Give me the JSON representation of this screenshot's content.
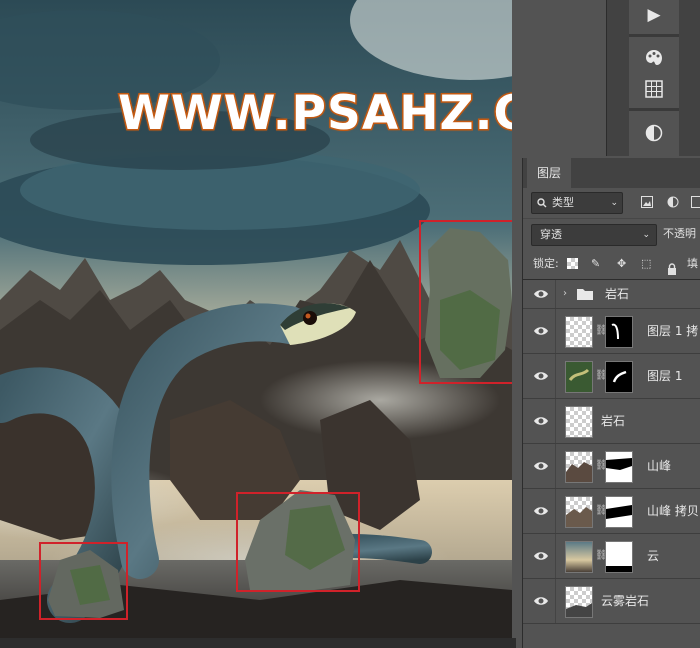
{
  "watermark": "WWW.PSAHZ.COM",
  "status_text": "",
  "toolbar": {
    "items": [
      {
        "icon": "play-icon",
        "glyph": "▶"
      },
      {
        "icon": "palette-icon",
        "glyph": "🎨"
      },
      {
        "icon": "grid-icon",
        "glyph": "▦"
      },
      {
        "icon": "adjustment-icon",
        "glyph": "◐"
      }
    ]
  },
  "panel": {
    "tab": "图层",
    "filter_kind": "类型",
    "blend_mode": "穿透",
    "opacity_label": "不透明",
    "lock_label": "锁定:",
    "fill_label": "填"
  },
  "layers": [
    {
      "name": "岩石",
      "type": "group"
    },
    {
      "name": "图层 1 拷",
      "type": "snake-mask"
    },
    {
      "name": "图层 1",
      "type": "snake-mask2"
    },
    {
      "name": "岩石",
      "type": "checker"
    },
    {
      "name": "山峰",
      "type": "mountain-mask"
    },
    {
      "name": "山峰 拷贝",
      "type": "mountain-mask2"
    },
    {
      "name": "云",
      "type": "sky-mask"
    },
    {
      "name": "云雾岩石",
      "type": "checker2"
    }
  ],
  "colors": {
    "panel_bg": "#535353",
    "highlight_box": "#d0222a",
    "watermark_stroke": "#c45a12"
  }
}
